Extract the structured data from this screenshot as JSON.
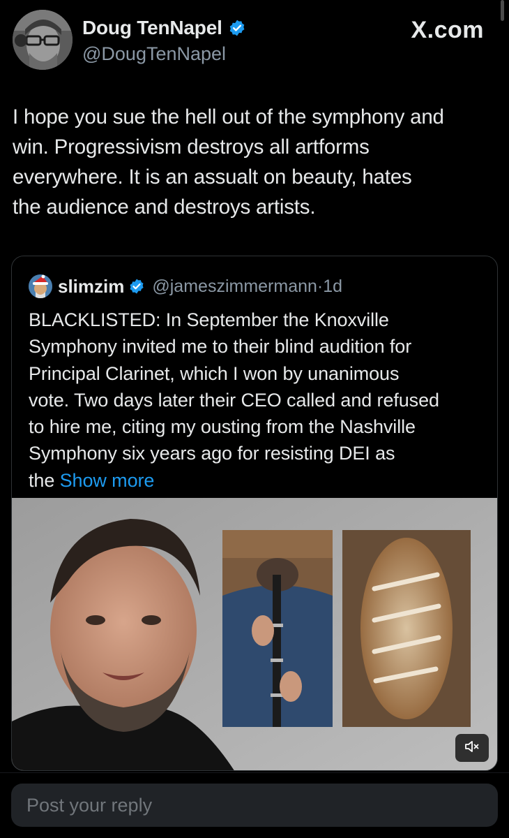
{
  "author": {
    "display_name": "Doug TenNapel",
    "handle": "@DougTenNapel",
    "verified": true
  },
  "source_label": "X.com",
  "tweet": {
    "text_lines": [
      "I hope you sue the hell out of the symphony and",
      "win. Progressivism destroys all artforms",
      "everywhere. It is an assualt on beauty, hates",
      "the audience and destroys artists."
    ]
  },
  "quoted_tweet": {
    "display_name": "slimzim",
    "handle": "@jameszimmermann",
    "separator": "·",
    "time": "1d",
    "text_lines": [
      "BLACKLISTED: In September the Knoxville",
      "Symphony invited me to their blind audition for",
      "Principal Clarinet, which I won by unanimous",
      "vote. Two days later their CEO called and refused",
      "to hire me, citing my ousting from the Nashville",
      "Symphony six years ago for resisting DEI as"
    ],
    "last_line_prefix": "the ",
    "show_more_label": "Show more"
  },
  "reply": {
    "placeholder": "Post your reply"
  },
  "colors": {
    "background": "#000000",
    "accent": "#1d9bf0",
    "secondary_text": "#8b98a5",
    "border": "#2f3336"
  },
  "icons": {
    "verified": "verified-badge-icon",
    "mute": "volume-muted-icon"
  }
}
